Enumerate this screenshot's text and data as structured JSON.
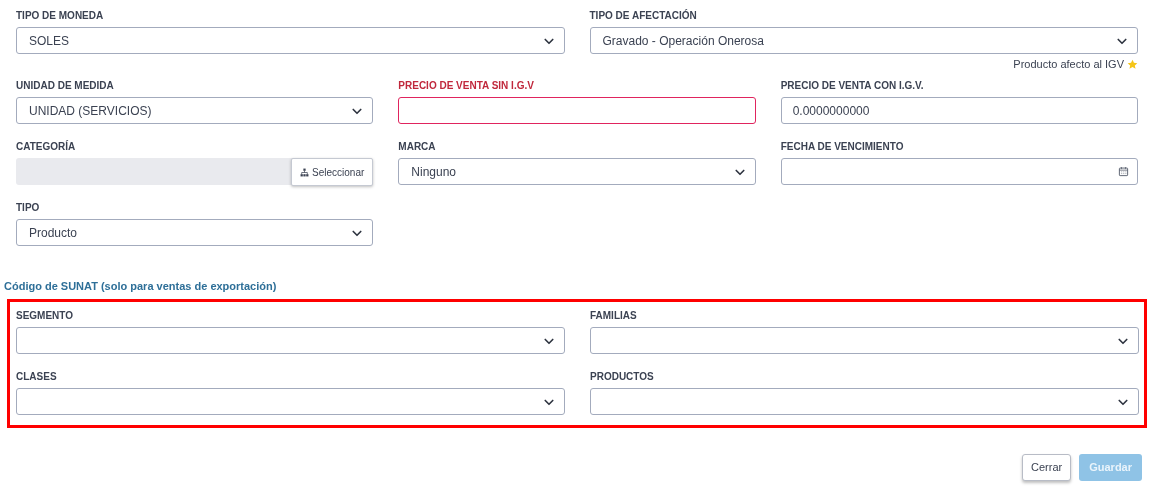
{
  "general": {
    "rows": [
      [
        {
          "label": "TIPO DE MONEDA",
          "kind": "select",
          "value": "SOLES",
          "invalid": false
        },
        {
          "label": "TIPO DE AFECTACIÓN",
          "kind": "select",
          "value": "Gravado - Operación Onerosa",
          "invalid": false
        }
      ],
      [
        {
          "label": "UNIDAD DE MEDIDA",
          "kind": "select",
          "value": "UNIDAD (SERVICIOS)",
          "invalid": false
        },
        {
          "label": "PRECIO DE VENTA SIN I.G.V",
          "kind": "input",
          "invalid": true
        },
        {
          "label": "PRECIO DE VENTA CON I.G.V.",
          "kind": "input",
          "value": "0.0000000000",
          "invalid": false
        }
      ],
      [
        {
          "label": "CATEGORÍA",
          "kind": "picker",
          "button": "Seleccionar",
          "invalid": false
        },
        {
          "label": "MARCA",
          "kind": "select",
          "value": "Ninguno",
          "invalid": false
        },
        {
          "label": "FECHA DE VENCIMIENTO",
          "kind": "date",
          "invalid": false
        }
      ],
      [
        {
          "label": "TIPO",
          "kind": "select",
          "value": "Producto",
          "invalid": false
        }
      ]
    ],
    "note": "Producto afecto al IGV"
  },
  "sunat": {
    "title": "Código de SUNAT (solo para ventas de exportación)",
    "fields": [
      {
        "label": "SEGMENTO",
        "kind": "select"
      },
      {
        "label": "FAMILIAS",
        "kind": "select"
      },
      {
        "label": "CLASES",
        "kind": "select"
      },
      {
        "label": "PRODUCTOS",
        "kind": "select"
      }
    ]
  },
  "buttons": [
    {
      "label": "Cerrar",
      "disabled": false
    },
    {
      "label": "Guardar",
      "disabled": true
    }
  ]
}
